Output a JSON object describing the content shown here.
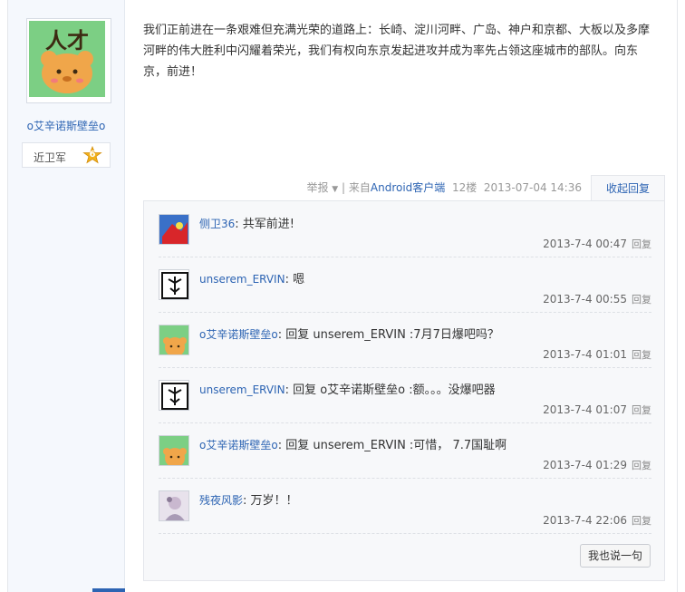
{
  "author": {
    "name": "o艾辛诺斯壁垒o",
    "rank_label": "近卫军",
    "rank_level": "6",
    "avatar_text": "人才"
  },
  "post": {
    "content": "我们正前进在一条艰难但充满光荣的道路上：长崎、淀川河畔、广岛、神户和京都、大板以及多摩河畔的伟大胜利中闪耀着荣光，我们有权向东京发起进攻并成为率先占领这座城市的部队。向东京，前进！"
  },
  "meta": {
    "report": "举报",
    "from_prefix": "| 来自",
    "device": "Android客户端",
    "floor": "12楼",
    "time": "2013-07-04 14:36",
    "collapse": "收起回复"
  },
  "replies": [
    {
      "user": "侧卫36",
      "sep": ": ",
      "text": "共军前进!",
      "time": "2013-7-4 00:47",
      "reply": "回复"
    },
    {
      "user": "unserem_ERVIN",
      "sep": ": ",
      "text": "嗯",
      "time": "2013-7-4 00:55",
      "reply": "回复"
    },
    {
      "user": "o艾辛诺斯壁垒o",
      "sep": ": ",
      "text": "回复 unserem_ERVIN :7月7日爆吧吗？",
      "time": "2013-7-4 01:01",
      "reply": "回复"
    },
    {
      "user": "unserem_ERVIN",
      "sep": ": ",
      "text": "回复 o艾辛诺斯壁垒o :额。。。没爆吧器",
      "time": "2013-7-4 01:07",
      "reply": "回复"
    },
    {
      "user": "o艾辛诺斯壁垒o",
      "sep": ": ",
      "text": "回复 unserem_ERVIN :可惜， 7.7国耻啊",
      "time": "2013-7-4 01:29",
      "reply": "回复"
    },
    {
      "user": "残夜风影",
      "sep": ": ",
      "text": "万岁！！",
      "time": "2013-7-4 22:06",
      "reply": "回复"
    }
  ],
  "say_button": "我也说一句",
  "colors": {
    "link": "#2d64b3",
    "avatar_green": "#7ccf84",
    "bear": "#f0a64a"
  }
}
